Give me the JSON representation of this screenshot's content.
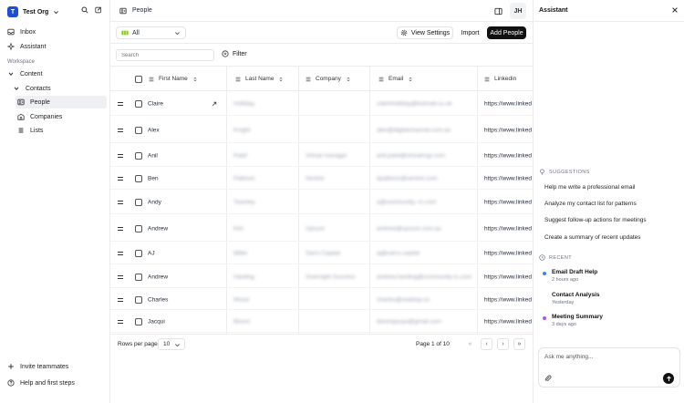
{
  "sidebar": {
    "org_initial": "T",
    "org_name": "Test Org",
    "items": [
      {
        "label": "Inbox",
        "icon": "inbox-icon"
      },
      {
        "label": "Assistant",
        "icon": "sparkle-icon"
      }
    ],
    "workspace_label": "Workspace",
    "content_label": "Content",
    "contacts_label": "Contacts",
    "sub_items": [
      {
        "label": "People",
        "icon": "people-icon",
        "active": true
      },
      {
        "label": "Companies",
        "icon": "building-icon",
        "active": false
      },
      {
        "label": "Lists",
        "icon": "list-icon",
        "active": false
      }
    ],
    "bottom": [
      {
        "label": "Invite teammates",
        "icon": "plus-icon"
      },
      {
        "label": "Help and first steps",
        "icon": "help-icon"
      }
    ]
  },
  "header": {
    "title": "People",
    "avatar_initials": "JH"
  },
  "toolbar": {
    "view_label": "All",
    "view_settings_label": "View Settings",
    "import_label": "Import",
    "add_label": "Add People"
  },
  "search": {
    "placeholder": "Search",
    "filter_label": "Filter"
  },
  "table": {
    "columns": [
      "First Name",
      "Last Name",
      "Company",
      "Email",
      "Linkedin"
    ],
    "rows": [
      {
        "first": "Claire",
        "last": "Holliday",
        "company": "",
        "email": "claireholliday@hotmail.co.uk",
        "linkedin": "https://www.linked"
      },
      {
        "first": "Alex",
        "last": "Knight",
        "company": "",
        "email": "alex@digitalchannel.com.au",
        "linkedin": "https://www.linked"
      },
      {
        "first": "Anil",
        "last": "Patel",
        "company": "Virtual manager",
        "email": "anil.patel@virtualmgr.com",
        "linkedin": "https://www.linked"
      },
      {
        "first": "Ben",
        "last": "Pattison",
        "company": "Sentrei",
        "email": "bpattison@sentrei.com",
        "linkedin": "https://www.linked"
      },
      {
        "first": "Andy",
        "last": "Townley",
        "company": "",
        "email": "a@community--rc.com",
        "linkedin": "https://www.linked"
      },
      {
        "first": "Andrew",
        "last": "Kim",
        "company": "Upsure",
        "email": "andrew@upsure.com.au",
        "linkedin": "https://www.linked"
      },
      {
        "first": "AJ",
        "last": "Miller",
        "company": "Sarro Capital",
        "email": "aj@sarro.capital",
        "linkedin": "https://www.linked"
      },
      {
        "first": "Andrew",
        "last": "Harding",
        "company": "Overnight Success",
        "email": "andrew.harding@community-rc.com",
        "linkedin": "https://www.linked"
      },
      {
        "first": "Charles",
        "last": "Wood",
        "company": "",
        "email": "charles@reaktop.co",
        "linkedin": "https://www.linked"
      },
      {
        "first": "Jacqui",
        "last": "Bloom",
        "company": "",
        "email": "bloomjacqui@gmail.com",
        "linkedin": "https://www.linked"
      }
    ]
  },
  "pagination": {
    "rows_per_page_label": "Rows per page",
    "rows_per_page": "10",
    "page_info": "Page 1 of 10",
    "first": "«",
    "prev": "‹",
    "next": "›",
    "last": "»"
  },
  "assistant": {
    "title": "Assistant",
    "suggestions_label": "SUGGESTIONS",
    "suggestions": [
      "Help me write a professional email",
      "Analyze my contact list for patterns",
      "Suggest follow-up actions for meetings",
      "Create a summary of recent updates"
    ],
    "recent_label": "RECENT",
    "recent": [
      {
        "title": "Email Draft Help",
        "time": "2 hours ago",
        "dot": "#3b82f6"
      },
      {
        "title": "Contact Analysis",
        "time": "Yesterday",
        "dot": ""
      },
      {
        "title": "Meeting Summary",
        "time": "3 days ago",
        "dot": "#a855f7"
      }
    ],
    "composer_placeholder": "Ask me anything..."
  },
  "colors": {
    "org_logo": "#1d4ed8",
    "view_badge": "#84cc16",
    "primary_button": "#111111"
  }
}
